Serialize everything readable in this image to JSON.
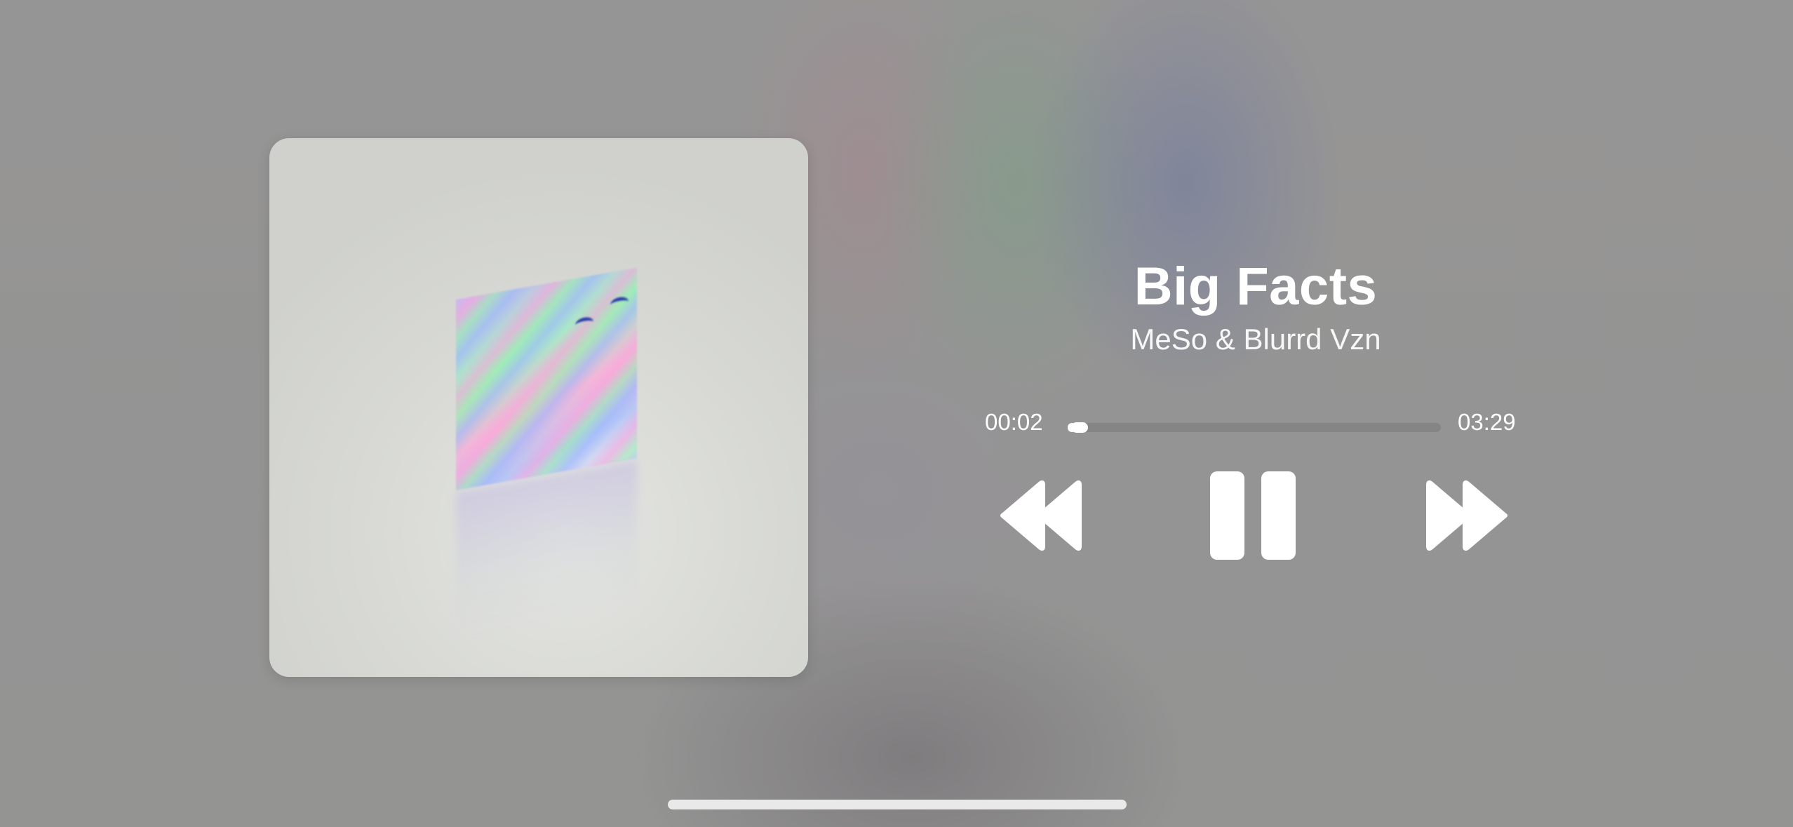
{
  "now_playing": {
    "title": "Big Facts",
    "artist": "MeSo & Blurrd Vzn",
    "elapsed": "00:02",
    "duration": "03:29",
    "progress_fraction": 0.01,
    "playing": true
  },
  "controls": {
    "rewind_icon": "backward-icon",
    "pause_icon": "pause-icon",
    "forward_icon": "forward-icon"
  },
  "colors": {
    "text": "#ffffff",
    "track": "#7f7f7f",
    "fill": "#ffffff"
  }
}
